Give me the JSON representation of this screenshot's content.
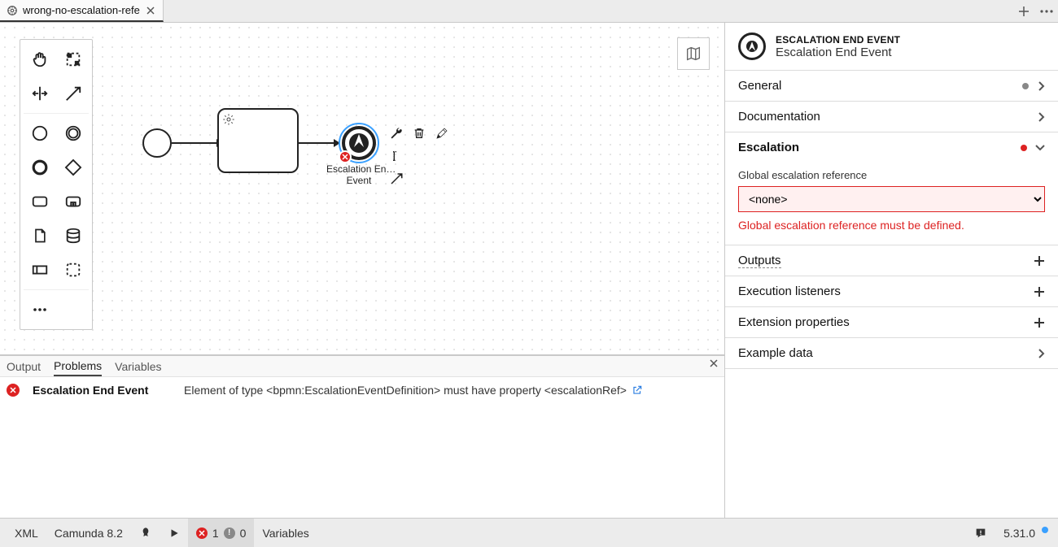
{
  "tab": {
    "title": "wrong-no-escalation-refe"
  },
  "canvas": {
    "end_event_label": "Escalation En…\nEvent"
  },
  "properties": {
    "header_type": "ESCALATION END EVENT",
    "header_name": "Escalation End Event",
    "sections": {
      "general": "General",
      "documentation": "Documentation",
      "escalation": "Escalation",
      "outputs": "Outputs",
      "execution_listeners": "Execution listeners",
      "extension_properties": "Extension properties",
      "example_data": "Example data"
    },
    "escalation": {
      "field_label": "Global escalation reference",
      "value": "<none>",
      "error": "Global escalation reference must be defined."
    }
  },
  "problems_panel": {
    "tabs": {
      "output": "Output",
      "problems": "Problems",
      "variables": "Variables"
    },
    "rows": [
      {
        "element": "Escalation End Event",
        "message": "Element of type <bpmn:EscalationEventDefinition> must have property <escalationRef>"
      }
    ]
  },
  "statusbar": {
    "xml": "XML",
    "engine": "Camunda 8.2",
    "errors": "1",
    "warnings": "0",
    "variables": "Variables",
    "version": "5.31.0"
  }
}
